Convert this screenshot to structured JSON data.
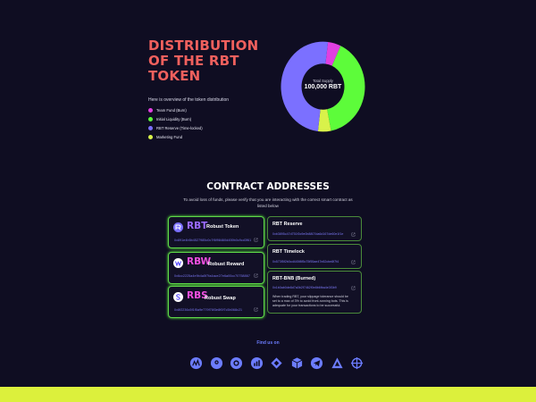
{
  "hero": {
    "title_line1": "DISTRIBUTION",
    "title_line2": "OF THE RBT",
    "title_line3": "TOKEN",
    "intro": "Here is overview of the token distribution",
    "legend": [
      {
        "label": "Team Fund (Burn)",
        "color": "#e040e0"
      },
      {
        "label": "Initial Liquidity (Burn)",
        "color": "#5dfc3a"
      },
      {
        "label": "RBT Reserve (Time-locked)",
        "color": "#7b70ff"
      },
      {
        "label": "Marketing Fund",
        "color": "#d9f24a"
      }
    ],
    "donut": {
      "caption": "Total Supply",
      "value": "100,000 RBT",
      "slices": [
        {
          "color": "#e040e0",
          "fraction": 0.05
        },
        {
          "color": "#5dfc3a",
          "fraction": 0.4
        },
        {
          "color": "#d9f24a",
          "fraction": 0.05
        },
        {
          "color": "#7b70ff",
          "fraction": 0.5
        }
      ]
    }
  },
  "contracts": {
    "title": "CONTRACT ADDRESSES",
    "description": "To avoid loss of funds, please verify that you are interacting with the correct smart contract as listed below",
    "tokens": [
      {
        "symbol": "RBT",
        "name": "Robust Token",
        "address": "0x891e4b5b4527985c0c7f6f98460d459b0c9cd3f61",
        "accent": "#9b6bff",
        "logo_bg": "#7b70ff",
        "logo_char": "R"
      },
      {
        "symbol": "RBW",
        "name": "Robust Reward",
        "address": "0x6cc2225a4e9b4a5f7fa4ace27e6a00cc70758867",
        "accent": "#f050e0",
        "logo_bg": "#ffffff",
        "logo_char": "W"
      },
      {
        "symbol": "RBS",
        "name": "Robust Swap",
        "address": "0x8f2236c5f1f5a9e779f76f3e8f0f7c5b068c21",
        "accent": "#f050e0",
        "logo_bg": "#ffffff",
        "logo_char": "S"
      }
    ],
    "right": [
      {
        "title": "RBT Reserve",
        "address": "0xb3895c47d751f0c9e0b8807da6d167de60e1f1e"
      },
      {
        "title": "RBT Timelock",
        "address": "0x573f5f2b0cd445f8f5c75f55ae47e82cbe8f7f4"
      },
      {
        "title": "RBT-BNB (Burned)",
        "address": "0x1b0ab0de8d7a0b2f7462f0e8b6fba4e3f3b9",
        "note": "When trading RBT, your slippage tolerance should be set to a max of 3% to avoid front-running bots. This is adequate for your transactions to be successful."
      }
    ]
  },
  "footer": {
    "find_us": "Find us on",
    "socials": [
      {
        "icon": "coinmarketcap-icon",
        "color": "#6c7cff"
      },
      {
        "icon": "coingecko-icon",
        "color": "#6c7cff"
      },
      {
        "icon": "dextools-icon",
        "color": "#6c7cff"
      },
      {
        "icon": "chart-icon",
        "color": "#6c7cff"
      },
      {
        "icon": "bsc-icon",
        "color": "#6c7cff"
      },
      {
        "icon": "box-icon",
        "color": "#6c7cff"
      },
      {
        "icon": "telegram-icon",
        "color": "#6c7cff"
      },
      {
        "icon": "triangle-icon",
        "color": "#6c7cff"
      },
      {
        "icon": "crosshair-icon",
        "color": "#6c7cff"
      }
    ],
    "bar_color": "#dcf03c"
  }
}
